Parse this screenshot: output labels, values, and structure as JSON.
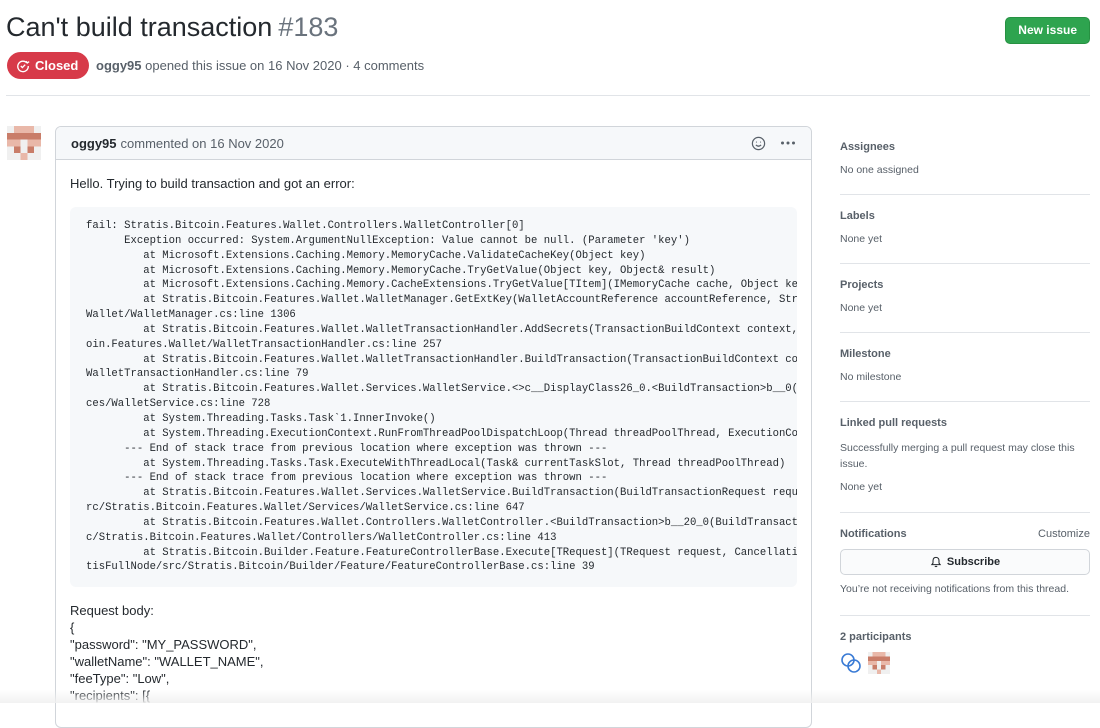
{
  "issue": {
    "title": "Can't build transaction",
    "number": "#183",
    "state": "Closed",
    "author": "oggy95",
    "meta_text": " opened this issue on 16 Nov 2020 · 4 comments",
    "new_issue_label": "New issue"
  },
  "comment": {
    "author": "oggy95",
    "date_text": "commented on 16 Nov 2020",
    "intro": "Hello. Trying to build transaction and got an error:",
    "code_lines": [
      "fail: Stratis.Bitcoin.Features.Wallet.Controllers.WalletController[0]",
      "      Exception occurred: System.ArgumentNullException: Value cannot be null. (Parameter 'key')",
      "         at Microsoft.Extensions.Caching.Memory.MemoryCache.ValidateCacheKey(Object key)",
      "         at Microsoft.Extensions.Caching.Memory.MemoryCache.TryGetValue(Object key, Object& result)",
      "         at Microsoft.Extensions.Caching.Memory.CacheExtensions.TryGetValue[TItem](IMemoryCache cache, Object ke",
      "         at Stratis.Bitcoin.Features.Wallet.WalletManager.GetExtKey(WalletAccountReference accountReference, Str",
      "Wallet/WalletManager.cs:line 1306",
      "         at Stratis.Bitcoin.Features.Wallet.WalletTransactionHandler.AddSecrets(TransactionBuildContext context,",
      "oin.Features.Wallet/WalletTransactionHandler.cs:line 257",
      "         at Stratis.Bitcoin.Features.Wallet.WalletTransactionHandler.BuildTransaction(TransactionBuildContext co",
      "WalletTransactionHandler.cs:line 79",
      "         at Stratis.Bitcoin.Features.Wallet.Services.WalletService.<>c__DisplayClass26_0.<BuildTransaction>b__0(",
      "ces/WalletService.cs:line 728",
      "         at System.Threading.Tasks.Task`1.InnerInvoke()",
      "         at System.Threading.ExecutionContext.RunFromThreadPoolDispatchLoop(Thread threadPoolThread, ExecutionCo",
      "      --- End of stack trace from previous location where exception was thrown ---",
      "         at System.Threading.Tasks.Task.ExecuteWithThreadLocal(Task& currentTaskSlot, Thread threadPoolThread)",
      "      --- End of stack trace from previous location where exception was thrown ---",
      "         at Stratis.Bitcoin.Features.Wallet.Services.WalletService.BuildTransaction(BuildTransactionRequest requ",
      "rc/Stratis.Bitcoin.Features.Wallet/Services/WalletService.cs:line 647",
      "         at Stratis.Bitcoin.Features.Wallet.Controllers.WalletController.<BuildTransaction>b__20_0(BuildTransact",
      "c/Stratis.Bitcoin.Features.Wallet/Controllers/WalletController.cs:line 413",
      "         at Stratis.Bitcoin.Builder.Feature.FeatureControllerBase.Execute[TRequest](TRequest request, Cancellati",
      "tisFullNode/src/Stratis.Bitcoin/Builder/Feature/FeatureControllerBase.cs:line 39"
    ],
    "body_lines": [
      "Request body:",
      "{",
      "\"password\": \"MY_PASSWORD\",",
      "\"walletName\": \"WALLET_NAME\",",
      "\"feeType\": \"Low\",",
      "\"recipients\": [{"
    ]
  },
  "sidebar": {
    "assignees": {
      "heading": "Assignees",
      "value": "No one assigned"
    },
    "labels": {
      "heading": "Labels",
      "value": "None yet"
    },
    "projects": {
      "heading": "Projects",
      "value": "None yet"
    },
    "milestone": {
      "heading": "Milestone",
      "value": "No milestone"
    },
    "linked": {
      "heading": "Linked pull requests",
      "description": "Successfully merging a pull request may close this issue.",
      "value": "None yet"
    },
    "notifications": {
      "heading": "Notifications",
      "customize": "Customize",
      "subscribe": "Subscribe",
      "note": "You’re not receiving notifications from this thread."
    },
    "participants": {
      "heading": "2 participants"
    }
  },
  "colors": {
    "closed": "#d73a49",
    "new_issue": "#2ea44f",
    "avatar_pink": "#e9b8a9",
    "avatar_dark": "#c97d69",
    "participant_blue": "#3a7bd5"
  }
}
